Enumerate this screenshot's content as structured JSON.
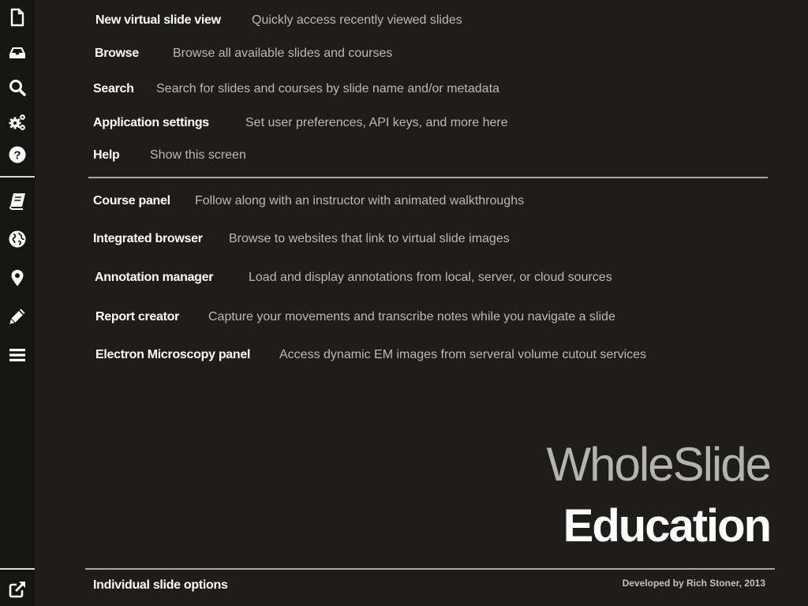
{
  "sidebar": {
    "icons": [
      {
        "name": "new-document-icon"
      },
      {
        "name": "inbox-tray-icon"
      },
      {
        "name": "search-icon"
      },
      {
        "name": "gears-icon"
      },
      {
        "name": "help-question-icon"
      },
      {
        "name": "book-icon"
      },
      {
        "name": "globe-icon"
      },
      {
        "name": "map-marker-icon"
      },
      {
        "name": "pencil-icon"
      },
      {
        "name": "menu-bars-icon"
      },
      {
        "name": "external-link-icon"
      }
    ]
  },
  "help": {
    "group1": [
      {
        "name": "New virtual slide view",
        "desc": "Quickly access recently viewed slides"
      },
      {
        "name": "Browse",
        "desc": "Browse all available slides and courses"
      },
      {
        "name": "Search",
        "desc": "Search for slides and courses by slide name and/or metadata"
      },
      {
        "name": "Application settings",
        "desc": "Set user preferences, API keys, and more here"
      },
      {
        "name": "Help",
        "desc": "Show this screen"
      }
    ],
    "group2": [
      {
        "name": "Course panel",
        "desc": "Follow along with an instructor with animated walkthroughs"
      },
      {
        "name": "Integrated browser",
        "desc": "Browse to websites that link to virtual slide images"
      },
      {
        "name": "Annotation manager",
        "desc": "Load and display annotations from local, server, or cloud sources"
      },
      {
        "name": "Report creator",
        "desc": "Capture your movements and transcribe notes while you navigate a slide"
      },
      {
        "name": "Electron Microscopy panel",
        "desc": "Access dynamic EM images from serveral volume cutout services"
      }
    ]
  },
  "brand": {
    "line1": "WholeSlide",
    "line2": "Education",
    "credits": "Developed by Rich Stoner, 2013"
  },
  "footer": {
    "label": "Individual slide options"
  },
  "colors": {
    "background": "#1e1d1a",
    "sidebar": "#151513",
    "label": "#ffffff",
    "description": "#b9b9b9",
    "brand_light": "#b3b3b3"
  }
}
